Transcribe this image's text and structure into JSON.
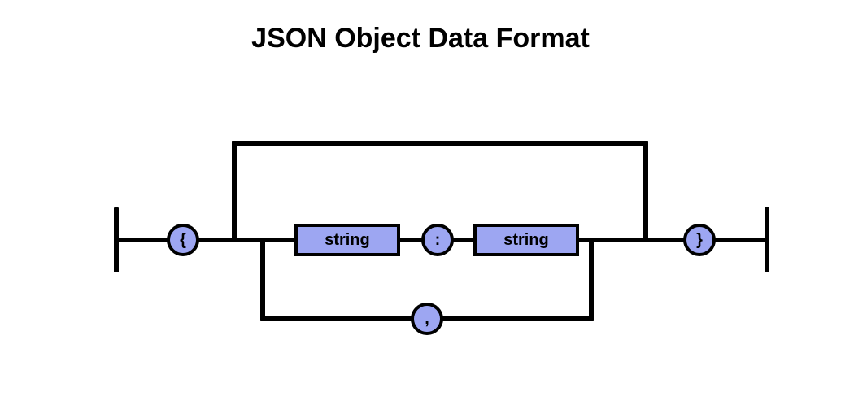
{
  "title": "JSON Object Data Format",
  "nodes": {
    "open_brace": "{",
    "close_brace": "}",
    "key_label": "string",
    "colon": ":",
    "value_label": "string",
    "comma": ","
  },
  "colors": {
    "fill": "#9DA6F2",
    "stroke": "#000000",
    "background": "#FFFFFF"
  },
  "diagram": {
    "type": "railroad",
    "describes": "JSON object",
    "entry": "open_brace",
    "exit": "close_brace",
    "bypass_empty_object": true,
    "loop_separator": "comma",
    "sequence": [
      "key_label",
      "colon",
      "value_label"
    ]
  }
}
